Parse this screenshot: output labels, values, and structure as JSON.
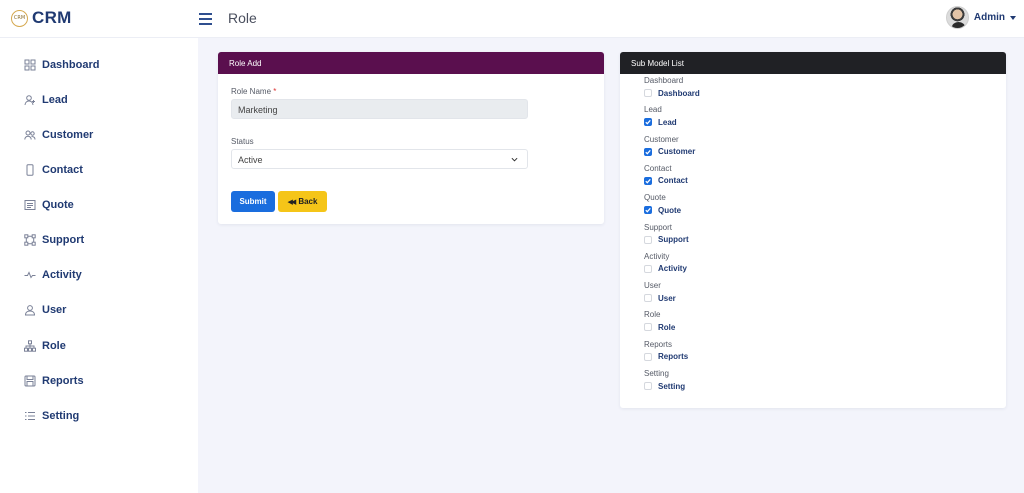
{
  "app": {
    "logo_badge": "CRM",
    "logo_text": "CRM"
  },
  "header": {
    "title": "Role",
    "user": "Admin"
  },
  "sidebar": {
    "items": [
      {
        "label": "Dashboard",
        "icon": "grid-icon"
      },
      {
        "label": "Lead",
        "icon": "user-plus-icon"
      },
      {
        "label": "Customer",
        "icon": "users-icon"
      },
      {
        "label": "Contact",
        "icon": "phone-icon"
      },
      {
        "label": "Quote",
        "icon": "list-box-icon"
      },
      {
        "label": "Support",
        "icon": "share-nodes-icon"
      },
      {
        "label": "Activity",
        "icon": "pulse-icon"
      },
      {
        "label": "User",
        "icon": "user-icon"
      },
      {
        "label": "Role",
        "icon": "hierarchy-icon"
      },
      {
        "label": "Reports",
        "icon": "save-icon"
      },
      {
        "label": "Setting",
        "icon": "list-icon"
      }
    ]
  },
  "role_form": {
    "header": "Role Add",
    "role_name_label": "Role Name",
    "required_mark": "*",
    "role_name_value": "Marketing",
    "status_label": "Status",
    "status_value": "Active",
    "submit_label": "Submit",
    "back_label": "Back",
    "back_icon": "◀◀"
  },
  "sub_models": {
    "header": "Sub Model List",
    "groups": [
      {
        "group": "Dashboard",
        "item": "Dashboard",
        "checked": false
      },
      {
        "group": "Lead",
        "item": "Lead",
        "checked": true
      },
      {
        "group": "Customer",
        "item": "Customer",
        "checked": true
      },
      {
        "group": "Contact",
        "item": "Contact",
        "checked": true
      },
      {
        "group": "Quote",
        "item": "Quote",
        "checked": true
      },
      {
        "group": "Support",
        "item": "Support",
        "checked": false
      },
      {
        "group": "Activity",
        "item": "Activity",
        "checked": false
      },
      {
        "group": "User",
        "item": "User",
        "checked": false
      },
      {
        "group": "Role",
        "item": "Role",
        "checked": false
      },
      {
        "group": "Reports",
        "item": "Reports",
        "checked": false
      },
      {
        "group": "Setting",
        "item": "Setting",
        "checked": false
      }
    ]
  },
  "colors": {
    "brand": "#203a72",
    "role_header": "#5a0f4e",
    "sub_header": "#202125",
    "primary": "#1a6dde",
    "warning": "#f5c518"
  }
}
